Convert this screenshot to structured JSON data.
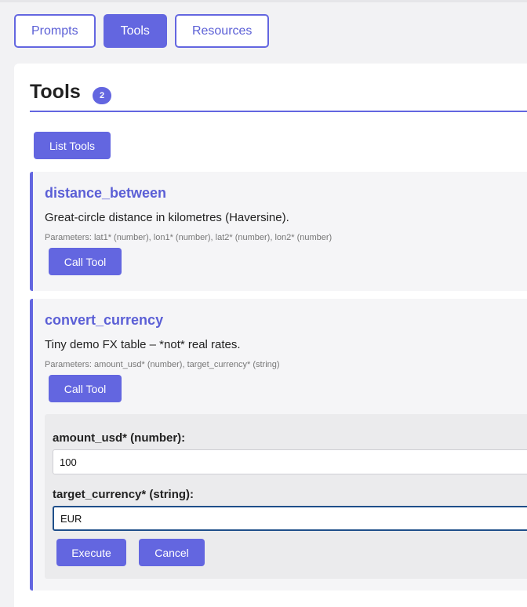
{
  "tabs": [
    {
      "label": "Prompts",
      "active": false
    },
    {
      "label": "Tools",
      "active": true
    },
    {
      "label": "Resources",
      "active": false
    }
  ],
  "panel": {
    "title": "Tools",
    "count": "2",
    "list_button": "List Tools"
  },
  "tools": [
    {
      "name": "distance_between",
      "description": "Great-circle distance in kilometres (Haversine).",
      "parameters": "Parameters: lat1* (number), lon1* (number), lat2* (number), lon2* (number)",
      "call_label": "Call Tool"
    },
    {
      "name": "convert_currency",
      "description": "Tiny demo FX table – *not* real rates.",
      "parameters": "Parameters: amount_usd* (number), target_currency* (string)",
      "call_label": "Call Tool"
    }
  ],
  "form": {
    "field1_label": "amount_usd* (number):",
    "field1_value": "100",
    "field2_label": "target_currency* (string):",
    "field2_value": "EUR",
    "execute_label": "Execute",
    "cancel_label": "Cancel"
  },
  "colors": {
    "accent": "#6366e0",
    "focus_border": "#1f4f8a"
  }
}
